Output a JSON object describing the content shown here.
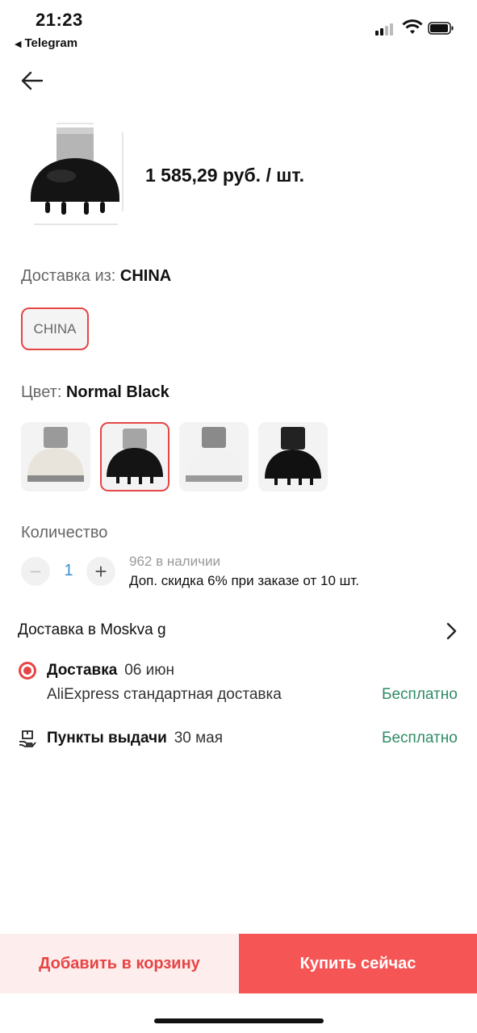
{
  "status_bar": {
    "time": "21:23",
    "back_app": "Telegram"
  },
  "product": {
    "price": "1 585,29 руб. / шт."
  },
  "ship_from": {
    "label": "Доставка из:",
    "value": "CHINA",
    "options": [
      "CHINA"
    ]
  },
  "color": {
    "label": "Цвет:",
    "value": "Normal Black",
    "swatches": [
      "white-gray",
      "black-gray",
      "white",
      "black"
    ],
    "selected_index": 1
  },
  "quantity": {
    "label": "Количество",
    "value": "1",
    "stock": "962 в наличии",
    "discount": "Доп. скидка 6% при заказе от 10 шт."
  },
  "delivery": {
    "header": "Доставка в Moskva g",
    "courier": {
      "title": "Доставка",
      "date": "06 июн",
      "method": "AliExpress стандартная доставка",
      "price": "Бесплатно"
    },
    "pickup": {
      "title": "Пункты выдачи",
      "date": "30 мая",
      "price": "Бесплатно"
    }
  },
  "actions": {
    "add_to_cart": "Добавить в корзину",
    "buy_now": "Купить сейчас"
  },
  "colors": {
    "accent": "#e64545",
    "buy_bg": "#f65555",
    "cart_bg": "#fdeded",
    "free": "#2e8c65",
    "link": "#3a8fcf"
  }
}
